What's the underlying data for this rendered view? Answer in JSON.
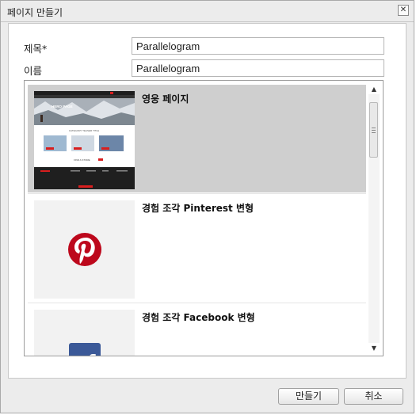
{
  "dialog": {
    "title": "페이지 만들기",
    "close_glyph": "✕",
    "form": {
      "title_label": "제목*",
      "title_value": "Parallelogram",
      "name_label": "이름",
      "name_value": "Parallelogram"
    },
    "templates": [
      {
        "title": "영웅 페이지",
        "selected": true
      },
      {
        "title": "경험 조각 Pinterest 변형",
        "selected": false
      },
      {
        "title": "경험 조각 Facebook 변형",
        "selected": false
      }
    ],
    "thumb": {
      "hero_text": "HERO PAGE",
      "category_text": "CATEGORY TEASER TITLE",
      "find_text": "FIND A STORE",
      "facebook_glyph": "f"
    },
    "buttons": {
      "create": "만들기",
      "cancel": "취소"
    }
  }
}
